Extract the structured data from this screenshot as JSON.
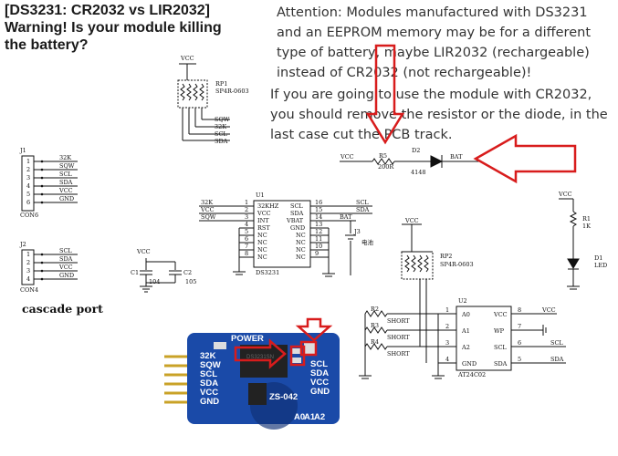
{
  "heading": {
    "line1": "[DS3231: CR2032 vs LIR2032]",
    "line2": "Warning! Is your module killing",
    "line3": "the battery?"
  },
  "notes": {
    "attention": "Attention: Modules manufactured with DS3231 and an EEPROM memory may be for a different type of battery, maybe LIR2032 (rechargeable) instead of CR2032 (not rechargeable)!",
    "advice": "If you are going to use the module with CR2032, you should remove the resistor or the diode, in the last case cut the PCB track."
  },
  "schematic": {
    "vcc": "VCC",
    "rp1": "RP1",
    "rp1_type": "SP4R-0603",
    "rp2": "RP2",
    "rp2_type": "SP4R-0603",
    "j1": "J1",
    "j1_name": "CON6",
    "j1_pins": [
      "32K",
      "SQW",
      "SCL",
      "SDA",
      "VCC",
      "GND"
    ],
    "j1_nums": [
      "1",
      "2",
      "3",
      "4",
      "5",
      "6"
    ],
    "j2": "J2",
    "j2_name": "CON4",
    "j2_pins": [
      "SCL",
      "SDA",
      "VCC",
      "GND"
    ],
    "j2_nums": [
      "1",
      "2",
      "3",
      "4"
    ],
    "cascade": "cascade port",
    "rp1_outs": [
      "SQW",
      "32K",
      "SCL",
      "SDA"
    ],
    "u1": "U1",
    "u1_name": "DS3231",
    "u1_left": [
      "32KHZ",
      "VCC",
      "INT",
      "RST",
      "NC",
      "NC",
      "NC",
      "NC"
    ],
    "u1_left_num": [
      "1",
      "2",
      "3",
      "4",
      "5",
      "6",
      "7",
      "8"
    ],
    "u1_right": [
      "SCL",
      "SDA",
      "VBAT",
      "GND",
      "NC",
      "NC",
      "NC",
      "NC"
    ],
    "u1_right_num": [
      "16",
      "15",
      "14",
      "13",
      "12",
      "11",
      "10",
      "9"
    ],
    "u1_in": [
      "32K",
      "VCC",
      "SQW"
    ],
    "u1_out": [
      "SCL",
      "SDA",
      "BAT"
    ],
    "j3": "J3",
    "j3_sub": "电池",
    "c1": "C1",
    "c1_val": "104",
    "c2": "C2",
    "c2_val": "105",
    "r5": "R5",
    "r5_val": "200R",
    "d2": "D2",
    "d2_val": "4148",
    "bat": "BAT",
    "r1": "R1",
    "r1_val": "1K",
    "d1": "D1",
    "d1_val": "LED",
    "u2": "U2",
    "u2_name": "AT24C02",
    "u2_left": [
      "A0",
      "A1",
      "A2",
      "GND"
    ],
    "u2_left_num": [
      "1",
      "2",
      "3",
      "4"
    ],
    "u2_right": [
      "VCC",
      "WP",
      "SCL",
      "SDA"
    ],
    "u2_right_num": [
      "8",
      "7",
      "6",
      "5"
    ],
    "r2": "R2",
    "r3": "R3",
    "r4": "R4",
    "short": "SHORT"
  },
  "board": {
    "label": "ZS-042",
    "power": "POWER",
    "left_pins": [
      "32K",
      "SQW",
      "SCL",
      "SDA",
      "VCC",
      "GND"
    ],
    "right_pins": [
      "SCL",
      "SDA",
      "VCC",
      "GND"
    ],
    "addr": [
      "A0",
      "A1",
      "A2"
    ],
    "chip": "DS3231SN"
  },
  "colors": {
    "arrow": "#d81c1c",
    "board": "#1a4aa8",
    "ink": "#111111"
  }
}
